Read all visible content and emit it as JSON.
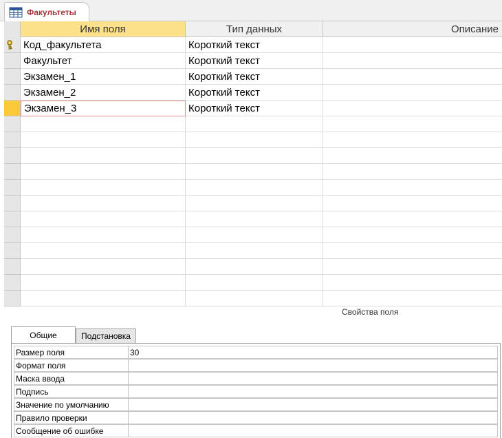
{
  "tab": {
    "label": "Факультеты",
    "icon": "table-icon"
  },
  "grid": {
    "columns": [
      "Имя поля",
      "Тип данных",
      "Описание"
    ],
    "rows": [
      {
        "name": "Код_факультета",
        "type": "Короткий текст",
        "description": "",
        "primary_key": true
      },
      {
        "name": "Факультет",
        "type": "Короткий текст",
        "description": ""
      },
      {
        "name": "Экзамен_1",
        "type": "Короткий текст",
        "description": ""
      },
      {
        "name": "Экзамен_2",
        "type": "Короткий текст",
        "description": ""
      },
      {
        "name": "Экзамен_3",
        "type": "Короткий текст",
        "description": "",
        "current": true
      }
    ]
  },
  "properties": {
    "title": "Свойства поля",
    "tabs": [
      "Общие",
      "Подстановка"
    ],
    "items": [
      {
        "label": "Размер поля",
        "value": "30"
      },
      {
        "label": "Формат поля",
        "value": ""
      },
      {
        "label": "Маска ввода",
        "value": ""
      },
      {
        "label": "Подпись",
        "value": ""
      },
      {
        "label": "Значение по умолчанию",
        "value": ""
      },
      {
        "label": "Правило проверки",
        "value": ""
      },
      {
        "label": "Сообщение об ошибке",
        "value": ""
      }
    ]
  },
  "colors": {
    "accent": "#a4373a",
    "active_header": "#fde08a",
    "current_row": "#fbc93a"
  }
}
